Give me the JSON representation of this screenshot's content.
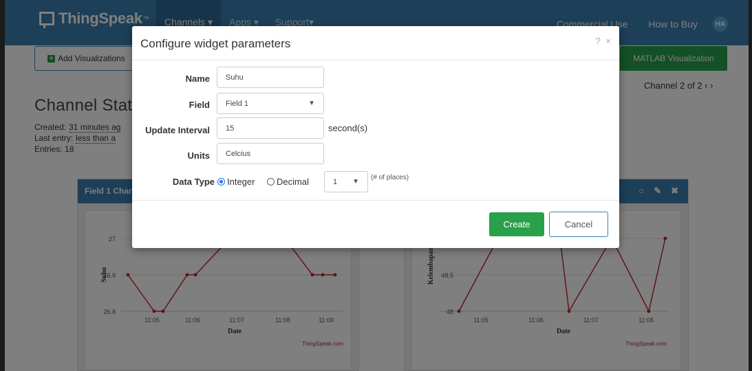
{
  "navbar": {
    "brand": "ThingSpeak",
    "brand_tm": "™",
    "menu": [
      {
        "label": "Channels ▾"
      },
      {
        "label": "Apps ▾"
      },
      {
        "label": "Support▾"
      }
    ],
    "commercial_use": "Commercial Use",
    "how_to_buy": "How to Buy",
    "avatar_initials": "HA"
  },
  "toolbar": {
    "add_visualizations": "Add Visualizations",
    "matlab_visualization": "MATLAB Visualization",
    "channel_nav": "Channel 2 of 2 ‹ ›"
  },
  "page": {
    "title": "Channel Stat",
    "created_label": "Created:",
    "created_value": "31 minutes ag",
    "last_entry_label": "Last entry:",
    "last_entry_value": "less than a",
    "entries": "Entries: 18"
  },
  "charts": {
    "left": {
      "header": "Field 1 Char",
      "ylabel": "Suhu",
      "xlabel": "Date",
      "watermark": "ThingSpeak.com",
      "y_ticks": [
        "27",
        "26.9",
        "26.8"
      ],
      "x_ticks": [
        "11:05",
        "11:06",
        "11:07",
        "11:08",
        "11:09"
      ]
    },
    "right": {
      "ylabel": "Kelembapan",
      "xlabel": "Date",
      "watermark": "ThingSpeak.com",
      "y_ticks": [
        "48.5",
        "48"
      ],
      "x_ticks": [
        "11:05",
        "11:06",
        "11:07",
        "11:08"
      ]
    },
    "line_color": "#c0282d"
  },
  "modal": {
    "title": "Configure widget parameters",
    "tools": "? ×",
    "name_label": "Name",
    "name_value": "Suhu",
    "field_label": "Field",
    "field_value": "Field 1",
    "interval_label": "Update Interval",
    "interval_value": "15",
    "interval_unit": "second(s)",
    "units_label": "Units",
    "units_value": "Celcius",
    "datatype_label": "Data Type",
    "integer_label": "Integer",
    "decimal_label": "Decimal",
    "places_value": "1",
    "places_hint": "(# of places)",
    "create": "Create",
    "cancel": "Cancel"
  }
}
